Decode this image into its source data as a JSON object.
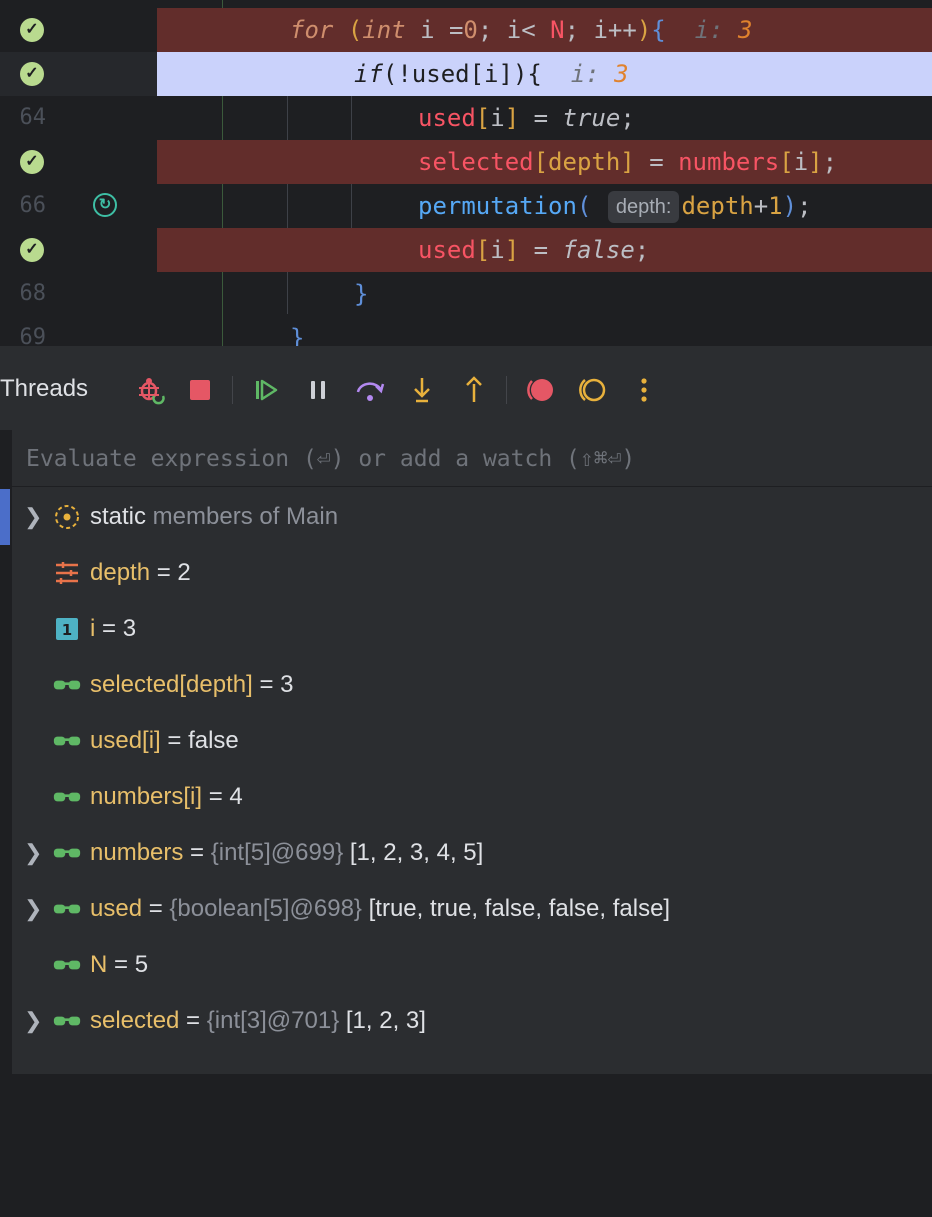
{
  "editor": {
    "lines": [
      {
        "num": "",
        "code": "for (int i =0; i< N; i++){  i: 3"
      },
      {
        "num": "",
        "code": "if(!used[i]){  i: 3"
      },
      {
        "num": "64",
        "code": "used[i] = true;"
      },
      {
        "num": "",
        "code": "selected[depth] = numbers[i];"
      },
      {
        "num": "66",
        "code": "permutation( depth: depth+1);"
      },
      {
        "num": "",
        "code": "used[i] = false;"
      },
      {
        "num": "68",
        "code": "}"
      },
      {
        "num": "69",
        "code": "}"
      }
    ],
    "inline_var_label": "i:",
    "inline_var_value": "3",
    "param_hint": "depth:"
  },
  "toolbar": {
    "title": "Threads",
    "buttons": [
      "rerun-debug",
      "stop",
      "resume",
      "pause",
      "step-over",
      "step-into",
      "step-out",
      "view-breakpoints",
      "mute-breakpoints",
      "more"
    ]
  },
  "variables": {
    "eval_placeholder": "Evaluate expression (⏎) or add a watch (⇧⌘⏎)",
    "rows": [
      {
        "name": "static",
        "rest": " members of Main",
        "icon": "static-members-icon",
        "expandable": true
      },
      {
        "name": "depth",
        "rest": " = 2",
        "icon": "parameter-icon",
        "expandable": false
      },
      {
        "name": "i",
        "rest": " = 3",
        "icon": "local-variable-icon",
        "expandable": false
      },
      {
        "name": "selected[depth]",
        "rest": " = 3",
        "icon": "watch-icon",
        "expandable": false
      },
      {
        "name": "used[i]",
        "rest": " = false",
        "icon": "watch-icon",
        "expandable": false
      },
      {
        "name": "numbers[i]",
        "rest": " = 4",
        "icon": "watch-icon",
        "expandable": false
      },
      {
        "name": "numbers",
        "eq": " = ",
        "ref": "{int[5]@699}",
        "value": " [1, 2, 3, 4, 5]",
        "icon": "watch-icon",
        "expandable": true
      },
      {
        "name": "used",
        "eq": " = ",
        "ref": "{boolean[5]@698}",
        "value": " [true, true, false, false, false]",
        "icon": "watch-icon",
        "expandable": true
      },
      {
        "name": "N",
        "rest": " = 5",
        "icon": "watch-icon",
        "expandable": false
      },
      {
        "name": "selected",
        "eq": " = ",
        "ref": "{int[3]@701}",
        "value": " [1, 2, 3]",
        "icon": "watch-icon",
        "expandable": true
      }
    ]
  },
  "colors": {
    "breakpoint_hit_line": "#622d2b",
    "current_line": "#cad2fb",
    "breakpoint_check": "#b9da8f",
    "variable_name": "#e8bf6a"
  }
}
